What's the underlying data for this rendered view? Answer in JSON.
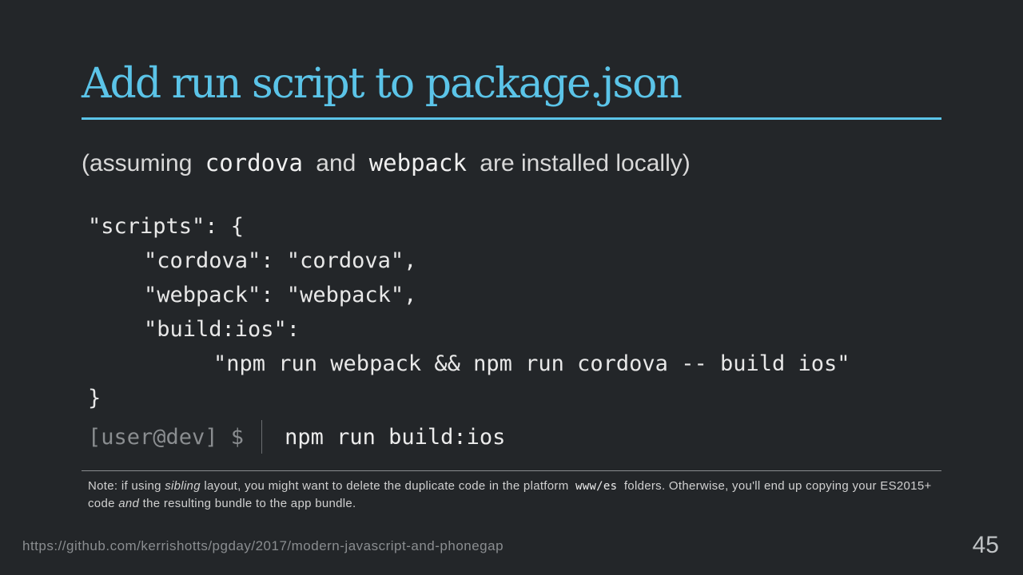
{
  "slide": {
    "title": "Add run script to package.json",
    "subtitle": {
      "open": "(assuming",
      "tool1": "cordova",
      "mid": "and",
      "tool2": "webpack",
      "close": "are installed locally)"
    },
    "code_lines": [
      "\"scripts\": {",
      "\"cordova\": \"cordova\",",
      "\"webpack\": \"webpack\",",
      "\"build:ios\":",
      "\"npm run webpack && npm run cordova -- build ios\"",
      "}"
    ],
    "terminal": {
      "prompt": "[user@dev] $",
      "command": "npm run build:ios"
    },
    "note": {
      "part1": "Note: if using",
      "em1": "sibling",
      "part2": "layout, you might want to delete the duplicate code in the platform",
      "code": "www/es",
      "part3": "folders. Otherwise, you'll end up copying your ES2015+ code",
      "em2": "and",
      "part4": "the resulting bundle to the app bundle."
    },
    "footer_url": "https://github.com/kerrishotts/pgday/2017/modern-javascript-and-phonegap",
    "page_number": "45"
  },
  "colors": {
    "background": "#232629",
    "accent": "#5bc4e8",
    "muted": "#8a8d90"
  }
}
